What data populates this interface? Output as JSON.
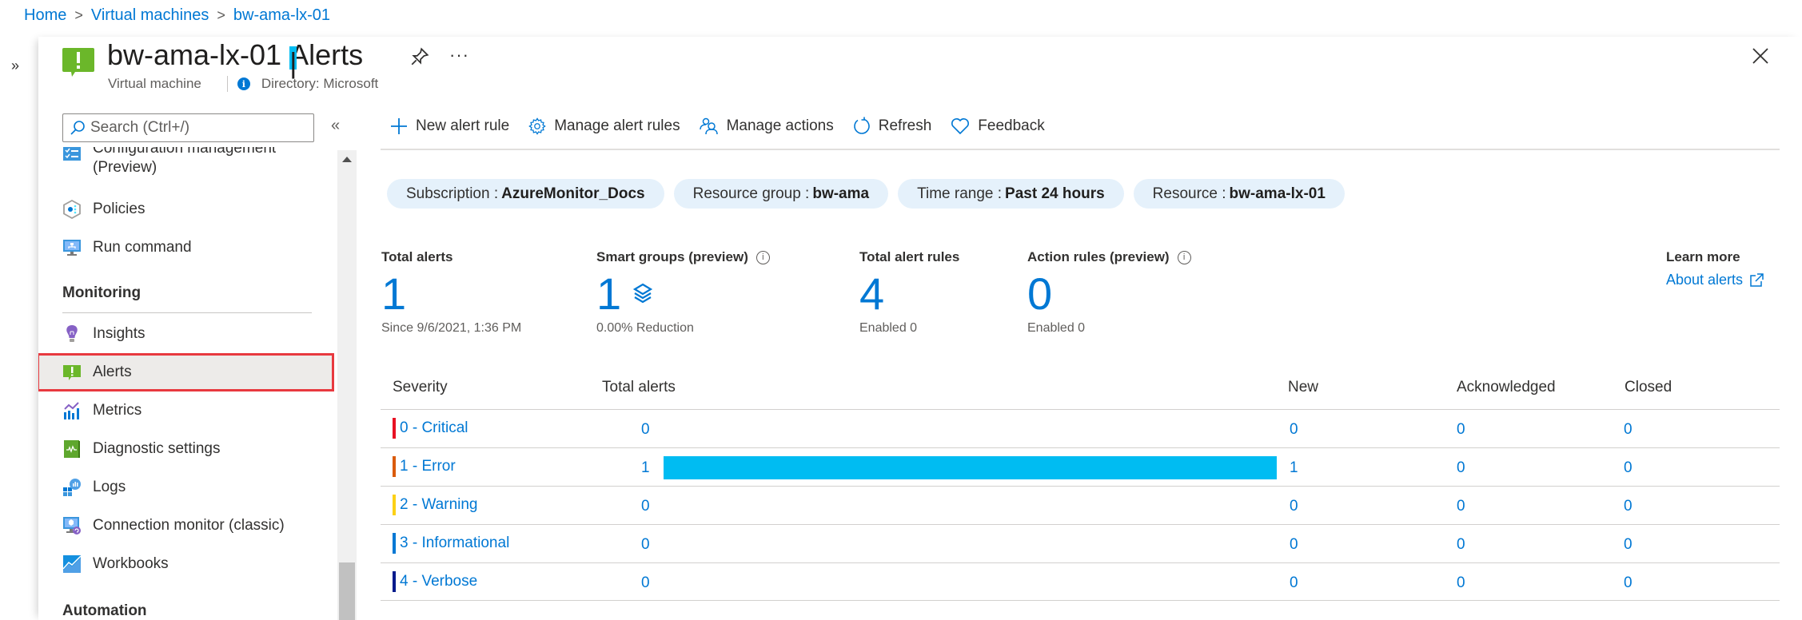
{
  "breadcrumb": [
    {
      "label": "Home"
    },
    {
      "label": "Virtual machines"
    },
    {
      "label": "bw-ama-lx-01"
    }
  ],
  "breadcrumb_separator": ">",
  "header": {
    "resource_name": "bw-ama-lx-01",
    "separator": "|",
    "page": "Alerts",
    "resource_type": "Virtual machine",
    "directory": "Directory: Microsoft",
    "more": "···",
    "icon": "alerts-icon"
  },
  "rail": {
    "expand_glyph": "»"
  },
  "sidebar": {
    "search_placeholder": "Search (Ctrl+/)",
    "collapse_glyph": "«",
    "items": [
      {
        "label": "Configuration management",
        "label2": "(Preview)",
        "icon": "configuration-management-icon"
      },
      {
        "label": "Policies",
        "icon": "policies-icon"
      },
      {
        "label": "Run command",
        "icon": "run-command-icon"
      },
      {
        "section": "Monitoring"
      },
      {
        "label": "Insights",
        "icon": "insights-icon"
      },
      {
        "label": "Alerts",
        "icon": "alerts-icon",
        "selected": true
      },
      {
        "label": "Metrics",
        "icon": "metrics-icon"
      },
      {
        "label": "Diagnostic settings",
        "icon": "diagnostic-settings-icon"
      },
      {
        "label": "Logs",
        "icon": "logs-icon"
      },
      {
        "label": "Connection monitor (classic)",
        "icon": "connection-monitor-icon"
      },
      {
        "label": "Workbooks",
        "icon": "workbooks-icon"
      },
      {
        "section": "Automation"
      }
    ]
  },
  "toolbar": {
    "new_alert_rule": "New alert rule",
    "manage_alert_rules": "Manage alert rules",
    "manage_actions": "Manage actions",
    "refresh": "Refresh",
    "feedback": "Feedback"
  },
  "filters": [
    {
      "key": "Subscription :",
      "value": "AzureMonitor_Docs"
    },
    {
      "key": "Resource group :",
      "value": "bw-ama"
    },
    {
      "key": "Time range :",
      "value": "Past 24 hours"
    },
    {
      "key": "Resource :",
      "value": "bw-ama-lx-01"
    }
  ],
  "summary": {
    "total_alerts": {
      "label": "Total alerts",
      "value": "1",
      "sub": "Since 9/6/2021, 1:36 PM"
    },
    "smart_groups": {
      "label": "Smart groups (preview)",
      "value": "1",
      "sub": "0.00% Reduction"
    },
    "total_alert_rules": {
      "label": "Total alert rules",
      "value": "4",
      "sub": "Enabled 0"
    },
    "action_rules": {
      "label": "Action rules (preview)",
      "value": "0",
      "sub": "Enabled 0"
    },
    "info_glyph": "i"
  },
  "learn_more": {
    "heading": "Learn more",
    "link": "About alerts"
  },
  "table": {
    "columns": [
      "Severity",
      "Total alerts",
      "New",
      "Acknowledged",
      "Closed"
    ],
    "max_total": 1,
    "rows": [
      {
        "severity": "0 - Critical",
        "color": "#e81123",
        "total": "0",
        "total_value": 0,
        "new": "0",
        "acknowledged": "0",
        "closed": "0"
      },
      {
        "severity": "1 - Error",
        "color": "#da5b0b",
        "total": "1",
        "total_value": 1,
        "new": "1",
        "acknowledged": "0",
        "closed": "0"
      },
      {
        "severity": "2 - Warning",
        "color": "#fcd116",
        "total": "0",
        "total_value": 0,
        "new": "0",
        "acknowledged": "0",
        "closed": "0"
      },
      {
        "severity": "3 - Informational",
        "color": "#0078d4",
        "total": "0",
        "total_value": 0,
        "new": "0",
        "acknowledged": "0",
        "closed": "0"
      },
      {
        "severity": "4 - Verbose",
        "color": "#001a8c",
        "total": "0",
        "total_value": 0,
        "new": "0",
        "acknowledged": "0",
        "closed": "0"
      }
    ]
  },
  "colors": {
    "accent": "#0078d4",
    "bar": "#00bcf2",
    "pill_bg": "#e5f1fb",
    "selected_outline": "#e8393f",
    "selected_bg": "#edebe9"
  }
}
